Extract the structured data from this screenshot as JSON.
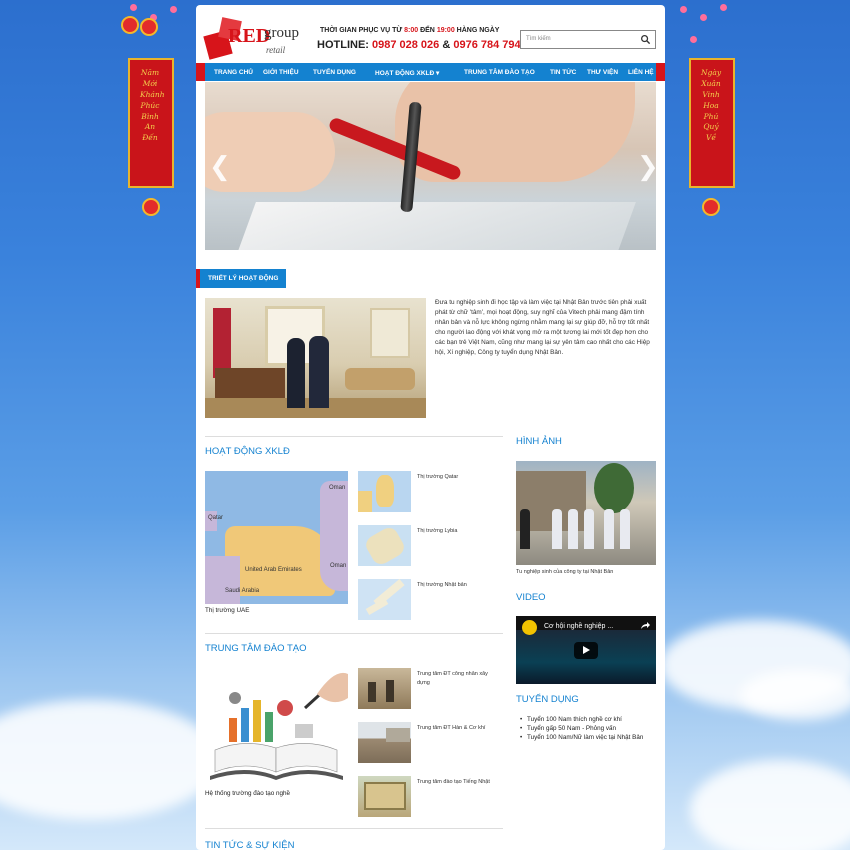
{
  "header": {
    "logo_red": "RED",
    "logo_group": "group",
    "logo_retail": "retail",
    "hours_prefix": "THỜI GIAN PHỤC VỤ TỪ ",
    "hours_start": "8:00",
    "hours_mid": " ĐẾN ",
    "hours_end": "19:00",
    "hours_suffix": " HÀNG NGÀY",
    "hotline_label": "HOTLINE: ",
    "hotline_1": "0987 028 026",
    "hotline_amp": " & ",
    "hotline_2": "0976 784 794",
    "search_placeholder": "Tìm kiếm"
  },
  "nav": {
    "items": [
      "TRANG CHỦ",
      "GIỚI THIỆU",
      "TUYỂN DỤNG",
      "HOẠT ĐỘNG XKLĐ",
      "TRUNG TÂM ĐÀO TẠO",
      "TIN TỨC",
      "THƯ VIỆN",
      "LIÊN HỆ"
    ]
  },
  "slider": {
    "prev": "❮",
    "next": "❯"
  },
  "philosophy": {
    "heading": "TRIẾT LÝ HOẠT ĐỘNG",
    "text": "Đưa tu nghiệp sinh đi học tập và làm việc tại Nhật Bản trước tiên phải xuất phát từ chữ 'tâm', mọi hoạt động, suy nghĩ của Vitech phải mang đậm tính nhân bản và nỗ lực không ngừng nhằm mang lại sự giúp đỡ, hỗ trợ tốt nhất cho người lao động với khát vọng mở ra một tương lai mới tốt đẹp hơn cho các bạn trẻ Việt Nam, cũng như mang lại sự yên tâm cao nhất cho các Hiệp hội, Xí nghiệp, Công ty tuyển dụng Nhật Bản."
  },
  "xkld": {
    "title": "HOẠT ĐỘNG XKLĐ",
    "main_caption": "Thị trường UAE",
    "map_labels": [
      "Qatar",
      "Oman",
      "United Arab Emirates",
      "Saudi Arabia",
      "Oman"
    ],
    "items": [
      "Thị trường Qatar",
      "Thị trường Lybia",
      "Thị trường Nhật bản"
    ]
  },
  "training": {
    "title": "TRUNG TÂM ĐÀO TẠO",
    "main_caption": "Hệ thống trường đào tạo nghề",
    "items": [
      "Trung tâm ĐT công nhân xây dựng",
      "Trung tâm ĐT Hàn & Cơ khí",
      "Trung tâm đào tạo Tiếng Nhật"
    ]
  },
  "news": {
    "title": "TIN TỨC & SỰ KIỆN"
  },
  "sidebar": {
    "images_title": "HÌNH ẢNH",
    "images_caption": "Tu nghiệp sinh của công ty tại Nhật Bản",
    "video_title": "VIDEO",
    "video_caption": "Cơ hội nghề nghiệp ...",
    "jobs_title": "TUYỂN DỤNG",
    "jobs": [
      "Tuyển 100 Nam thích nghề cơ khí",
      "Tuyển gấp 50 Nam - Phỏng vấn",
      "Tuyển 100 Nam/Nữ làm việc tại Nhật Bản"
    ]
  },
  "decor": {
    "left_couplet": [
      "Năm",
      "Mới",
      "Khánh",
      "Phúc",
      "Bình",
      "An",
      "Đến"
    ],
    "right_couplet": [
      "Ngày",
      "Xuân",
      "Vinh",
      "Hoa",
      "Phú",
      "Quý",
      "Về"
    ]
  },
  "colors": {
    "accent_blue": "#1482d0",
    "brand_red": "#d7141a"
  }
}
